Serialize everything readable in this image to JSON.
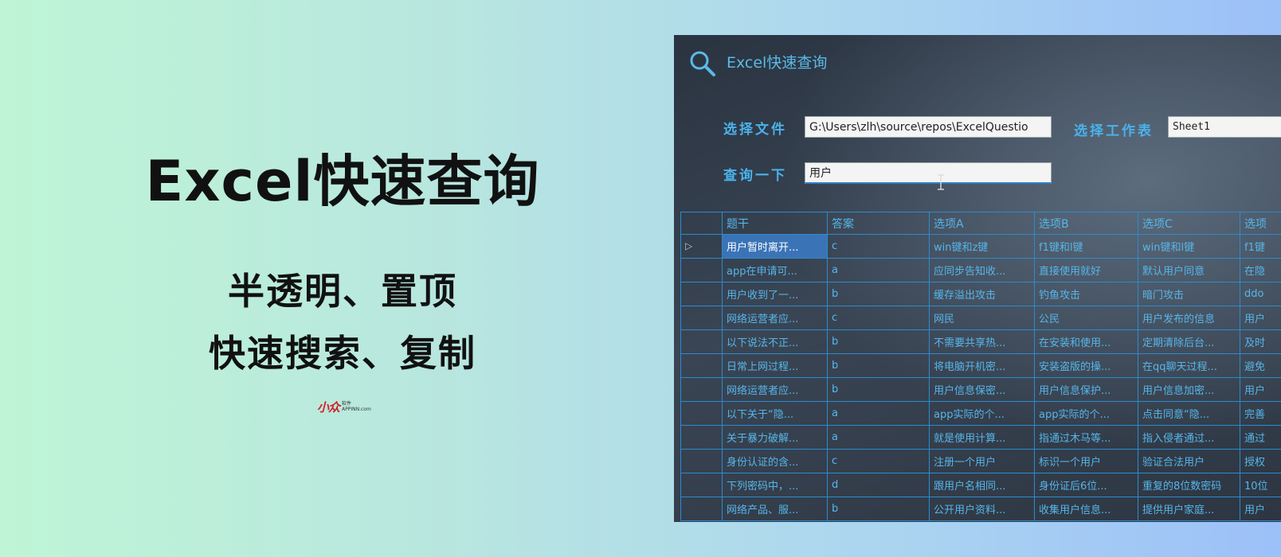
{
  "promo": {
    "title": "Excel快速查询",
    "line1": "半透明、置顶",
    "line2": "快速搜索、复制",
    "logo_mark": "小众",
    "logo_sub1": "软件",
    "logo_sub2": "APPINN.com"
  },
  "window": {
    "title": "Excel快速查询",
    "file_label": "选择文件",
    "file_value": "G:\\Users\\zlh\\source\\repos\\ExcelQuestio",
    "sheet_label": "选择工作表",
    "sheet_value": "Sheet1",
    "query_label": "查询一下",
    "query_value": "用户"
  },
  "table": {
    "columns": [
      "题干",
      "答案",
      "选项A",
      "选项B",
      "选项C",
      "选项"
    ],
    "current_row_marker": "▷",
    "rows": [
      [
        "用户暂时离开...",
        "c",
        "win键和z键",
        "f1键和l键",
        "win键和l键",
        "f1键"
      ],
      [
        "app在申请可...",
        "a",
        "应同步告知收...",
        "直接使用就好",
        "默认用户同意",
        "在隐"
      ],
      [
        "用户收到了一...",
        "b",
        "缓存溢出攻击",
        "钓鱼攻击",
        "暗门攻击",
        "ddo"
      ],
      [
        "网络运营者应...",
        "c",
        "网民",
        "公民",
        "用户发布的信息",
        "用户"
      ],
      [
        "以下说法不正...",
        "b",
        "不需要共享热...",
        "在安装和使用...",
        "定期清除后台...",
        "及时"
      ],
      [
        "日常上网过程...",
        "b",
        "将电脑开机密...",
        "安装盗版的操...",
        "在qq聊天过程...",
        "避免"
      ],
      [
        "网络运营者应...",
        "b",
        "用户信息保密...",
        "用户信息保护...",
        "用户信息加密...",
        "用户"
      ],
      [
        "以下关于“隐...",
        "a",
        "app实际的个...",
        "app实际的个...",
        "点击同意“隐...",
        "完善"
      ],
      [
        "关于暴力破解...",
        "a",
        "就是使用计算...",
        "指通过木马等...",
        "指入侵者通过...",
        "通过"
      ],
      [
        "身份认证的含...",
        "c",
        "注册一个用户",
        "标识一个用户",
        "验证合法用户",
        "授权"
      ],
      [
        "下列密码中，...",
        "d",
        "跟用户名相同...",
        "身份证后6位...",
        "重复的8位数密码",
        "10位"
      ],
      [
        "网络产品、服...",
        "b",
        "公开用户资料...",
        "收集用户信息...",
        "提供用户家庭...",
        "用户"
      ]
    ]
  }
}
